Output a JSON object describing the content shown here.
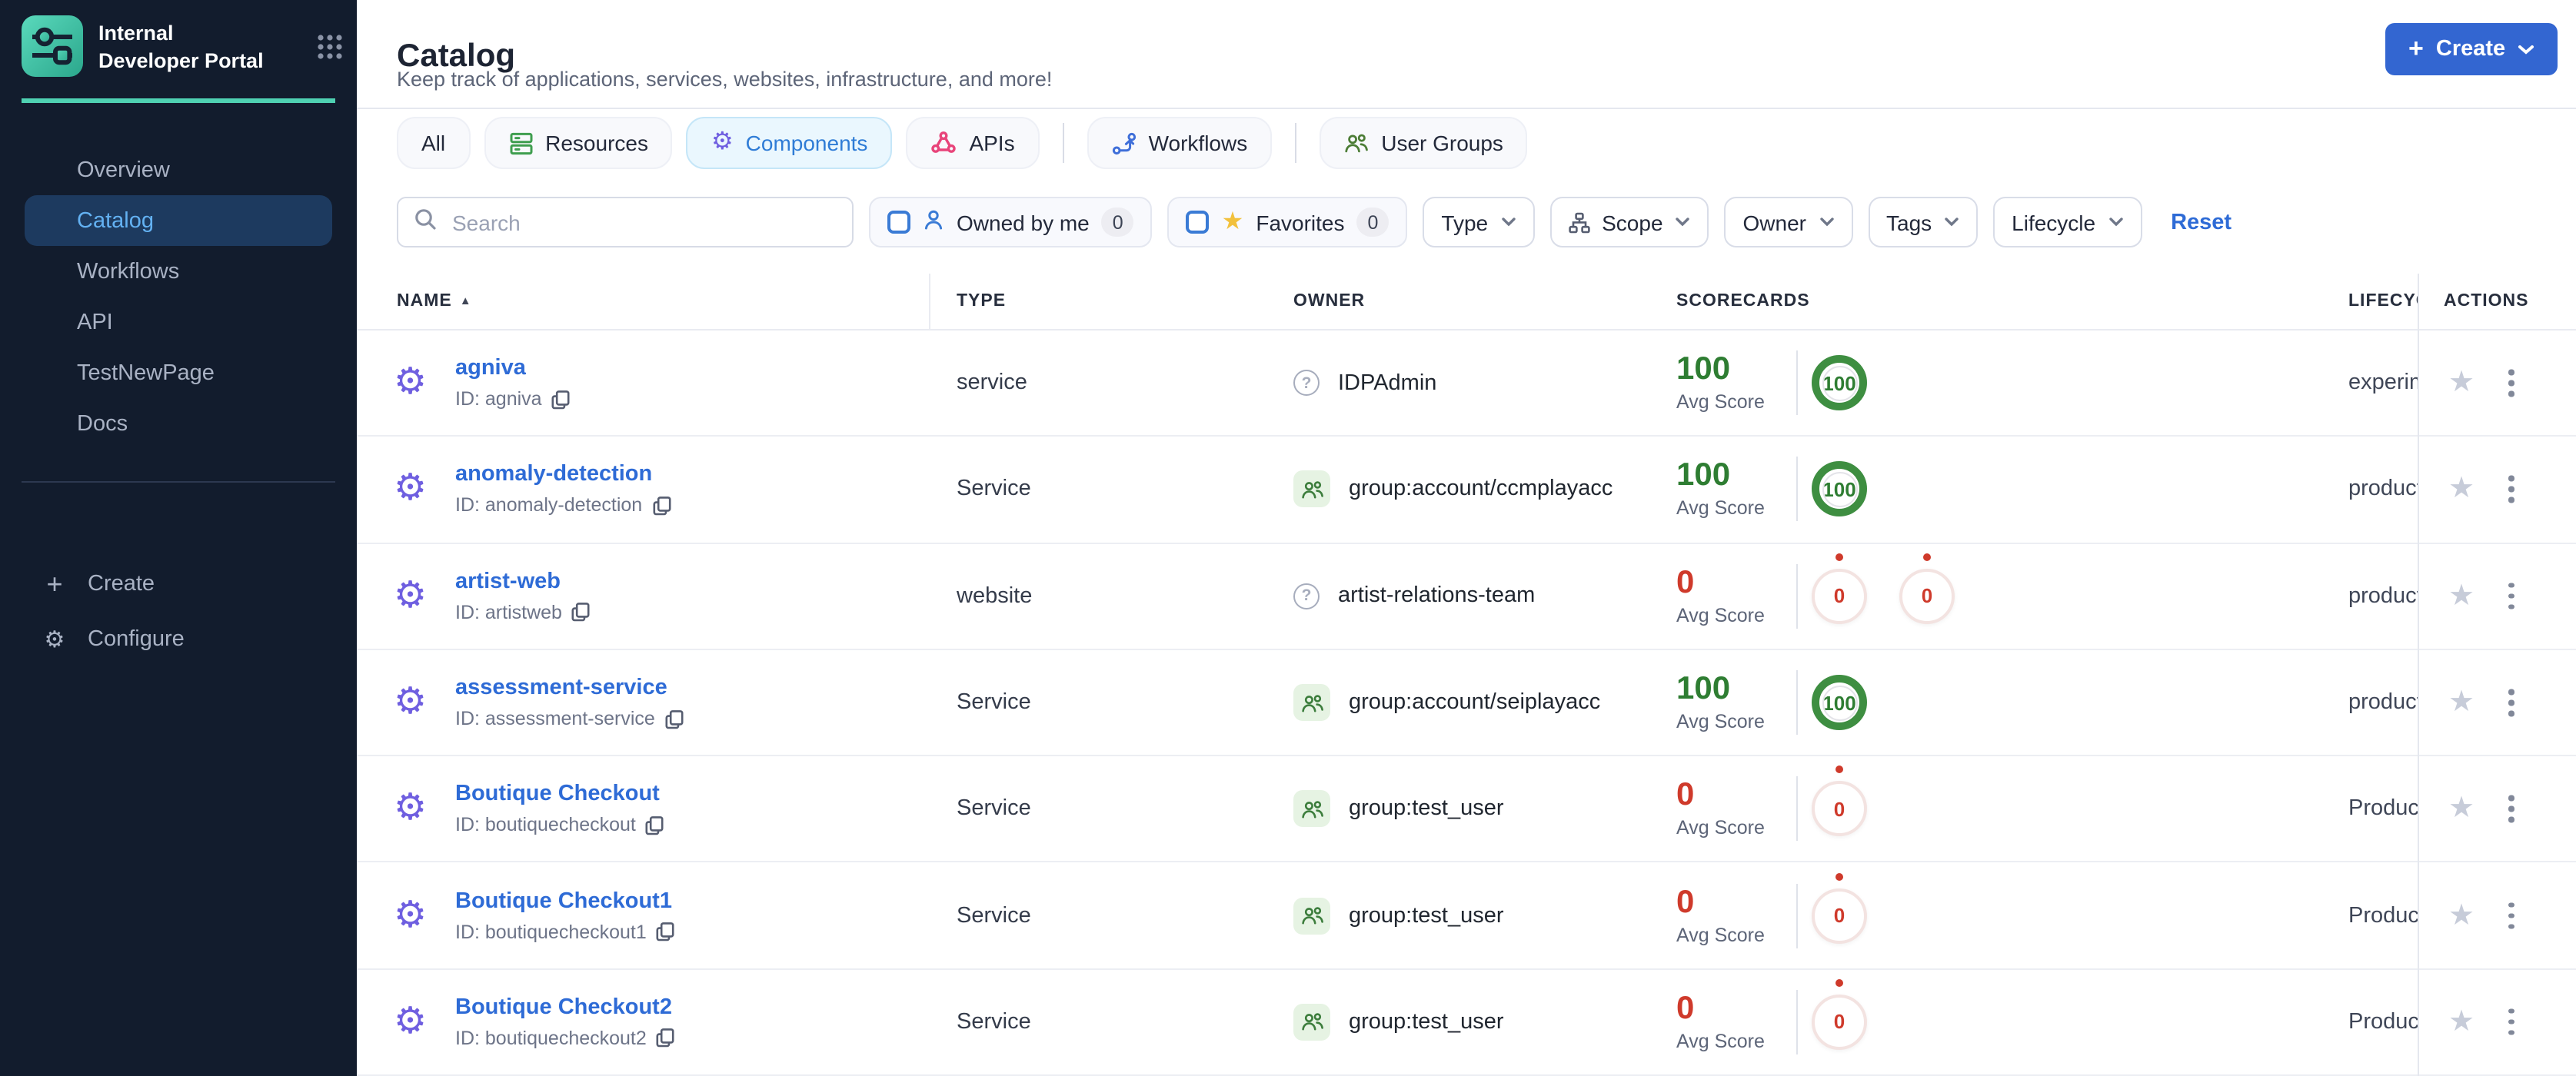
{
  "colors": {
    "sidebar_bg": "#121c2d",
    "teal_accent": "#4fd1b2",
    "sidebar_active_bg": "#1d3a5f",
    "sidebar_active_text": "#63b1f2",
    "create_button": "#3366d1",
    "link_blue": "#2e6bd6",
    "active_tab_bg": "#eaf7fe",
    "active_tab_text": "#2f7cd6",
    "gear_purple": "#6f5fe0",
    "score_good": "#2e7d32",
    "score_bad": "#cf3a2b"
  },
  "brand": {
    "title": "Internal Developer Portal"
  },
  "sidebar": {
    "items": [
      {
        "label": "Overview",
        "active": false
      },
      {
        "label": "Catalog",
        "active": true
      },
      {
        "label": "Workflows",
        "active": false
      },
      {
        "label": "API",
        "active": false
      },
      {
        "label": "TestNewPage",
        "active": false
      },
      {
        "label": "Docs",
        "active": false
      }
    ],
    "footer": [
      {
        "label": "Create",
        "icon": "plus-icon"
      },
      {
        "label": "Configure",
        "icon": "gear-icon"
      }
    ]
  },
  "header": {
    "title": "Catalog",
    "subtitle": "Keep track of applications, services, websites, infrastructure, and more!",
    "create_label": "Create"
  },
  "tabs": [
    {
      "label": "All"
    },
    {
      "label": "Resources",
      "icon": "resources-icon"
    },
    {
      "label": "Components",
      "icon": "components-icon",
      "active": true
    },
    {
      "label": "APIs",
      "icon": "apis-icon",
      "separator_after": true
    },
    {
      "label": "Workflows",
      "icon": "workflows-icon",
      "separator_after": true
    },
    {
      "label": "User Groups",
      "icon": "user-groups-icon"
    }
  ],
  "filters": {
    "search_placeholder": "Search",
    "owned_by_me": {
      "label": "Owned by me",
      "count": "0"
    },
    "favorites": {
      "label": "Favorites",
      "count": "0"
    },
    "dropdowns": [
      {
        "label": "Type"
      },
      {
        "label": "Scope",
        "icon": "scope-icon"
      },
      {
        "label": "Owner"
      },
      {
        "label": "Tags"
      },
      {
        "label": "Lifecycle"
      }
    ],
    "reset_label": "Reset"
  },
  "table": {
    "columns": [
      "NAME",
      "TYPE",
      "OWNER",
      "SCORECARDS",
      "LIFECYCLE",
      "ACTIONS"
    ],
    "sort_column": "NAME",
    "avg_score_label": "Avg Score",
    "rows": [
      {
        "name": "agniva",
        "id": "ID: agniva",
        "type": "service",
        "owner": {
          "icon": "help-icon",
          "label": "IDPAdmin"
        },
        "avg_score": "100",
        "score_state": "good",
        "badges": [
          {
            "value": "100",
            "state": "good"
          }
        ],
        "lifecycle": "experimental"
      },
      {
        "name": "anomaly-detection",
        "id": "ID: anomaly-detection",
        "type": "Service",
        "owner": {
          "icon": "group-icon",
          "label": "group:account/ccmplayacc"
        },
        "avg_score": "100",
        "score_state": "good",
        "badges": [
          {
            "value": "100",
            "state": "good"
          }
        ],
        "lifecycle": "production"
      },
      {
        "name": "artist-web",
        "id": "ID: artistweb",
        "type": "website",
        "owner": {
          "icon": "help-icon",
          "label": "artist-relations-team"
        },
        "avg_score": "0",
        "score_state": "bad",
        "badges": [
          {
            "value": "0",
            "state": "bad"
          },
          {
            "value": "0",
            "state": "bad"
          }
        ],
        "lifecycle": "production"
      },
      {
        "name": "assessment-service",
        "id": "ID: assessment-service",
        "type": "Service",
        "owner": {
          "icon": "group-icon",
          "label": "group:account/seiplayacc"
        },
        "avg_score": "100",
        "score_state": "good",
        "badges": [
          {
            "value": "100",
            "state": "good"
          }
        ],
        "lifecycle": "production"
      },
      {
        "name": "Boutique Checkout",
        "id": "ID: boutiquecheckout",
        "type": "Service",
        "owner": {
          "icon": "group-icon",
          "label": "group:test_user"
        },
        "avg_score": "0",
        "score_state": "bad",
        "badges": [
          {
            "value": "0",
            "state": "bad"
          }
        ],
        "lifecycle": "Production"
      },
      {
        "name": "Boutique Checkout1",
        "id": "ID: boutiquecheckout1",
        "type": "Service",
        "owner": {
          "icon": "group-icon",
          "label": "group:test_user"
        },
        "avg_score": "0",
        "score_state": "bad",
        "badges": [
          {
            "value": "0",
            "state": "bad"
          }
        ],
        "lifecycle": "Production"
      },
      {
        "name": "Boutique Checkout2",
        "id": "ID: boutiquecheckout2",
        "type": "Service",
        "owner": {
          "icon": "group-icon",
          "label": "group:test_user"
        },
        "avg_score": "0",
        "score_state": "bad",
        "badges": [
          {
            "value": "0",
            "state": "bad"
          }
        ],
        "lifecycle": "Production"
      }
    ]
  }
}
